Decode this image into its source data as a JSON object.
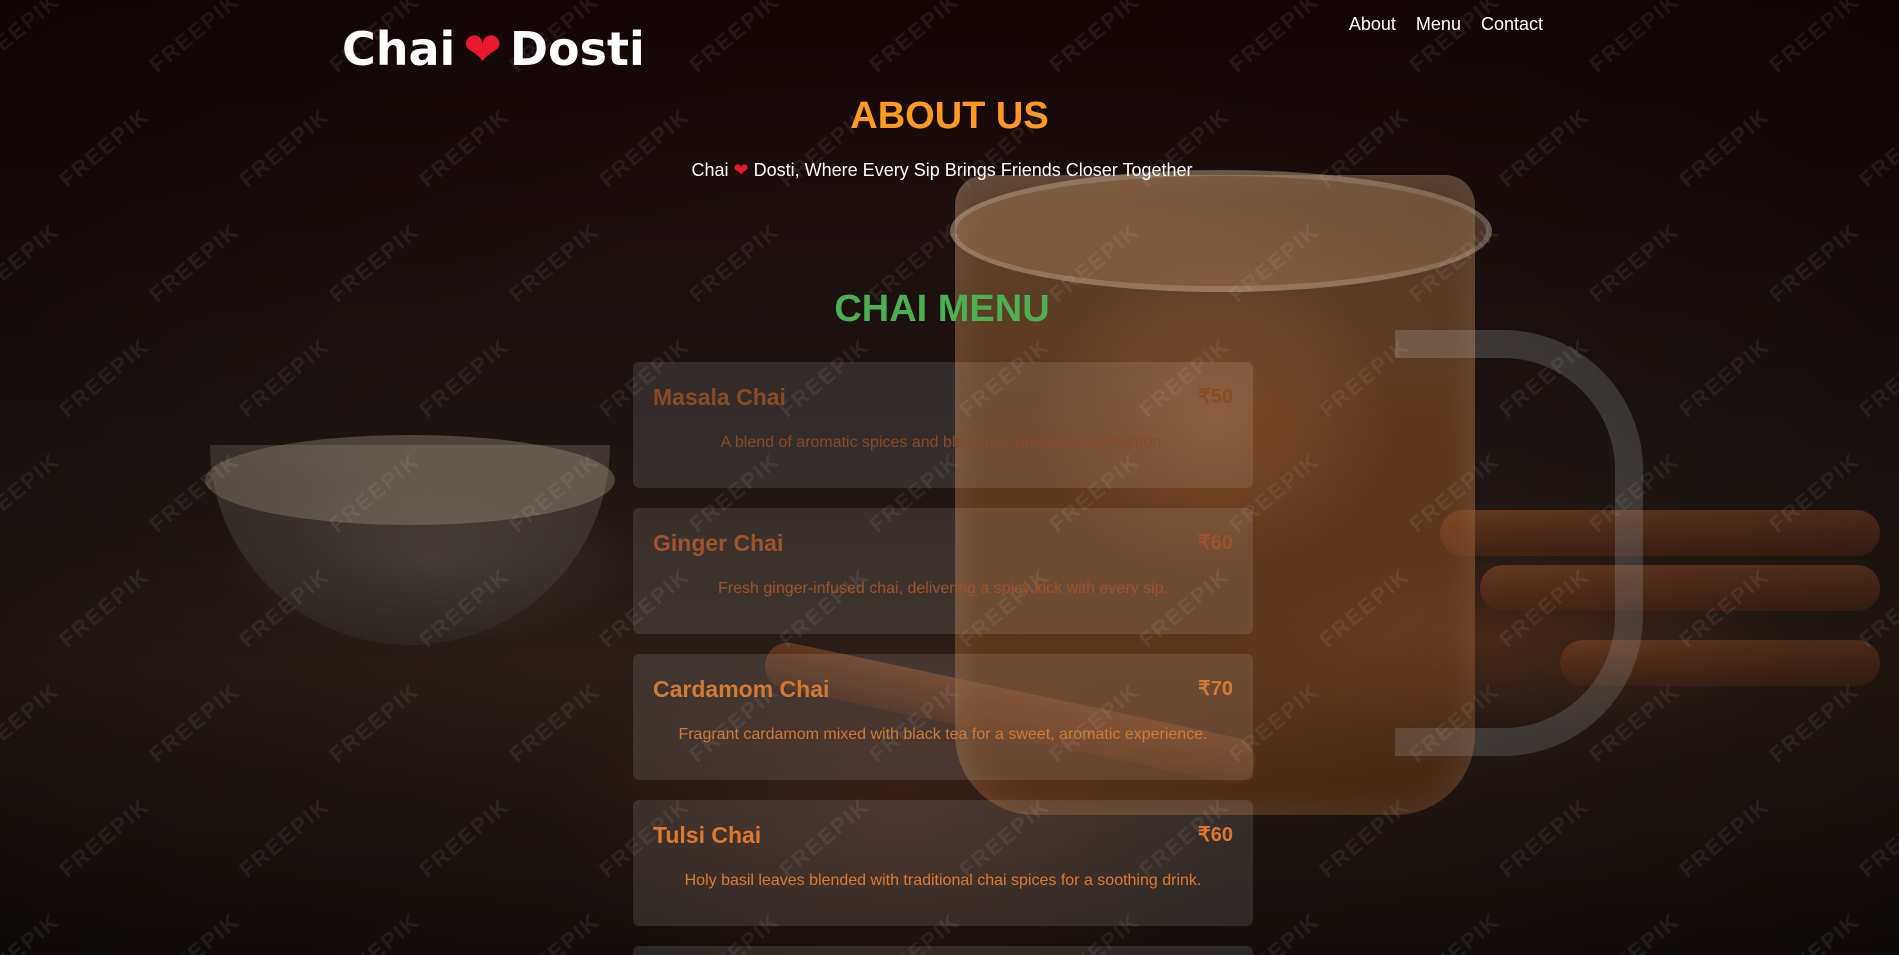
{
  "brand": {
    "name_part1": "Chai",
    "name_part2": "Dosti",
    "heart": "❤",
    "heart_color": "#e8192c"
  },
  "nav": {
    "items": [
      "About",
      "Menu",
      "Contact"
    ]
  },
  "about": {
    "title": "ABOUT US",
    "tagline_part1": "Chai",
    "tagline_heart": "❤",
    "tagline_part2": "Dosti, Where Every Sip Brings Friends Closer Together",
    "title_color": "#ff9a1f"
  },
  "menu": {
    "title": "CHAI MENU",
    "title_color": "#4caf50",
    "items": [
      {
        "name": "Masala Chai",
        "price": "₹50",
        "description": "A blend of aromatic spices and black tea, brewed to perfection.",
        "color": "#8a4a24"
      },
      {
        "name": "Ginger Chai",
        "price": "₹60",
        "description": "Fresh ginger-infused chai, delivering a spicy kick with every sip.",
        "color": "#a0532a"
      },
      {
        "name": "Cardamom Chai",
        "price": "₹70",
        "description": "Fragrant cardamom mixed with black tea for a sweet, aromatic experience.",
        "color": "#d07a34"
      },
      {
        "name": "Tulsi Chai",
        "price": "₹60",
        "description": "Holy basil leaves blended with traditional chai spices for a soothing drink.",
        "color": "#e0782c"
      }
    ]
  },
  "watermark": "FREEPIK"
}
